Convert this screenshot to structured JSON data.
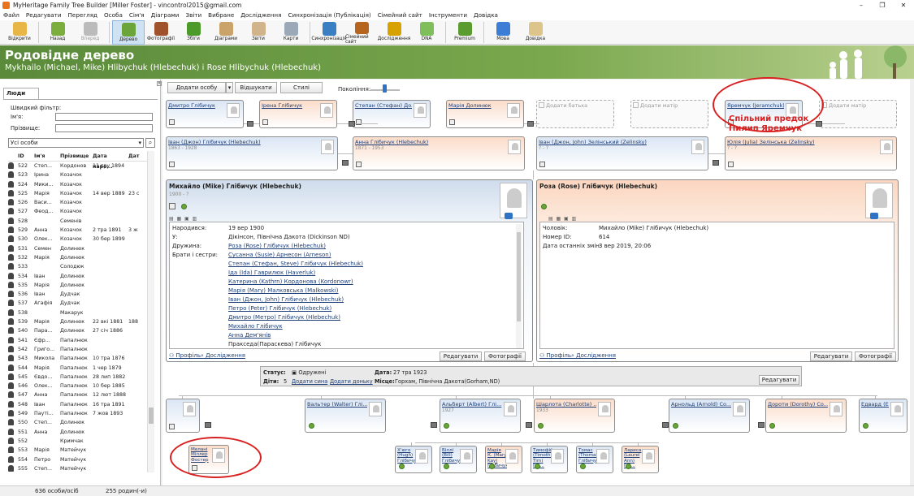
{
  "window": {
    "title": "MyHeritage Family Tree Builder [Miller Foster] - vincontrol2015@gmail.com",
    "min": "–",
    "max": "❐",
    "close": "✕"
  },
  "menu": [
    "Файл",
    "Редагувати",
    "Перегляд",
    "Особа",
    "Сім'я",
    "Діаграми",
    "Звіти",
    "Вибране",
    "Дослідження",
    "Синхронізація (Публікація)",
    "Сімейний сайт",
    "Інструменти",
    "Довідка"
  ],
  "toolbar": [
    {
      "label": "Відкрити",
      "icon": "folder-icon",
      "color": "#e8b646"
    },
    {
      "label": "Назад",
      "icon": "back-arrow-icon",
      "color": "#7cae3e"
    },
    {
      "label": "Вперед",
      "icon": "forward-arrow-icon",
      "color": "#bbbbbb"
    },
    {
      "label": "Дерево",
      "icon": "tree-icon",
      "color": "#6ba539"
    },
    {
      "label": "Фотографії",
      "icon": "photos-icon",
      "color": "#a0522d"
    },
    {
      "label": "Збіги",
      "icon": "matches-icon",
      "color": "#4c9a2a"
    },
    {
      "label": "Діаграми",
      "icon": "charts-icon",
      "color": "#c9a36a"
    },
    {
      "label": "Звіти",
      "icon": "reports-icon",
      "color": "#d2b48c"
    },
    {
      "label": "Карти",
      "icon": "map-icon",
      "color": "#9aa8b8"
    },
    {
      "label": "Синхронізація",
      "icon": "sync-icon",
      "color": "#3a7fc1"
    },
    {
      "label": "Сімейний сайт",
      "icon": "family-site-icon",
      "color": "#b5651d"
    },
    {
      "label": "Дослідження",
      "icon": "research-icon",
      "color": "#d7a100"
    },
    {
      "label": "DNA",
      "icon": "dna-icon",
      "color": "#7fbf5b"
    },
    {
      "label": "Premium",
      "icon": "premium-icon",
      "color": "#5a9c2f"
    },
    {
      "label": "Мова",
      "icon": "language-icon",
      "color": "#3c7dd6"
    },
    {
      "label": "Довідка",
      "icon": "help-icon",
      "color": "#dcc48a"
    }
  ],
  "banner": {
    "title": "Родовідне дерево",
    "subtitle": "Mykhailo (Michael, Mike) Hlibychuk (Hlebechuk) і Rose Hlibychuk (Hlebechuk)"
  },
  "left": {
    "tab": "Люди",
    "filter_title": "Швидкий фільтр:",
    "name_label": "Ім'я:",
    "surname_label": "Прізвище:",
    "filter_select": "Усі особи",
    "columns": [
      "",
      "ID",
      "Ім'я",
      "Прізвище",
      "Дата наро...",
      "Дат"
    ],
    "rows": [
      [
        "522",
        "Степ...",
        "Кордонов",
        "11 гру 1894",
        ""
      ],
      [
        "523",
        "Ірина",
        "Козачок",
        "",
        ""
      ],
      [
        "524",
        "Мики...",
        "Козачок",
        "",
        ""
      ],
      [
        "525",
        "Марія",
        "Козачок",
        "14 вер 1889",
        "23 с"
      ],
      [
        "526",
        "Васи...",
        "Козачок",
        "",
        ""
      ],
      [
        "527",
        "Феод...",
        "Козачок",
        "",
        ""
      ],
      [
        "528",
        "",
        "Семенів",
        "",
        ""
      ],
      [
        "529",
        "Анна",
        "Козачок",
        "2 тра 1891",
        "3 ж"
      ],
      [
        "530",
        "Олек...",
        "Козачок",
        "30 бер 1899",
        ""
      ],
      [
        "531",
        "Семен",
        "Долинюк",
        "",
        ""
      ],
      [
        "532",
        "Марія",
        "Долинюк",
        "",
        ""
      ],
      [
        "533",
        "",
        "Солодюк",
        "",
        ""
      ],
      [
        "534",
        "Іван",
        "Долинюк",
        "",
        ""
      ],
      [
        "535",
        "Марія",
        "Долинюк",
        "",
        ""
      ],
      [
        "536",
        "Іван",
        "Дудчак",
        "",
        ""
      ],
      [
        "537",
        "Агафія",
        "Дудчак",
        "",
        ""
      ],
      [
        "538",
        "",
        "Макарук",
        "",
        ""
      ],
      [
        "539",
        "Марія",
        "Долинюк",
        "22 вкі 1881",
        "188"
      ],
      [
        "540",
        "Пара...",
        "Долинюк",
        "27 січ 1886",
        ""
      ],
      [
        "541",
        "Єфр...",
        "Папалнюк",
        "",
        ""
      ],
      [
        "542",
        "Григо...",
        "Папалнюк",
        "",
        ""
      ],
      [
        "543",
        "Миколa",
        "Папалнюк",
        "10 тра 1876",
        ""
      ],
      [
        "544",
        "Марія",
        "Папалнюк",
        "1 чер 1879",
        ""
      ],
      [
        "545",
        "Євдо...",
        "Папалнюк",
        "28 лип 1882",
        ""
      ],
      [
        "546",
        "Олек...",
        "Папалнюк",
        "10 бер 1885",
        ""
      ],
      [
        "547",
        "Анна",
        "Папалнюк",
        "12 лют 1888",
        ""
      ],
      [
        "548",
        "Іван",
        "Папалнюк",
        "16 тра 1891",
        ""
      ],
      [
        "549",
        "Пауті...",
        "Папалнюк",
        "7 жов 1893",
        ""
      ],
      [
        "550",
        "Степ...",
        "Долинюк",
        "",
        ""
      ],
      [
        "551",
        "Анна",
        "Долинюк",
        "",
        ""
      ],
      [
        "552",
        "",
        "Кримчак",
        "",
        ""
      ],
      [
        "553",
        "Марія",
        "Матейчук",
        "",
        ""
      ],
      [
        "554",
        "Петро",
        "Матейчук",
        "",
        ""
      ],
      [
        "555",
        "Степ...",
        "Матейчук",
        "",
        ""
      ]
    ]
  },
  "status": {
    "persons": "636 особи/осіб",
    "families": "255 родин(-и)"
  },
  "tree": {
    "add_person": "Додати особу",
    "find": "Відшукати",
    "styles": "Стилі",
    "generations": "Покоління:",
    "ggp": [
      {
        "name": "Дмитро Глібичук",
        "sex": "m"
      },
      {
        "name": "Ірена Глібичук",
        "sex": "f"
      },
      {
        "name": "Степан (Стефан) Долинюк",
        "sex": "m"
      },
      {
        "name": "Марія Долинюк",
        "sex": "f"
      },
      {
        "name": "Додати батька",
        "sex": "add"
      },
      {
        "name": "Додати матір",
        "sex": "add"
      },
      {
        "name": "Яремчук (Jeramchuk)",
        "sex": "m"
      },
      {
        "name": "Додати матір",
        "sex": "add"
      }
    ],
    "gp": [
      {
        "name": "Іван (Джон) Глібичук (Hlebechuk)",
        "dates": "1863 - 1928",
        "sex": "m"
      },
      {
        "name": "Анна Глібичук (Hlebechuk)",
        "dates": "1871 - 1953",
        "sex": "f"
      },
      {
        "name": "Іван (Джон, John) Зелінський (Zelinsky)",
        "dates": "? - ?",
        "sex": "m"
      },
      {
        "name": "Юлія (Julia) Зелінська (Zelinsky)",
        "dates": "? - ?",
        "sex": "f"
      }
    ],
    "husband": {
      "name": "Михайло (Mike) Глібичук (Hlebechuk)",
      "dates": "1900 - ?",
      "fields": [
        [
          "Народився:",
          "19 вер 1900"
        ],
        [
          "У:",
          "Дікінсон, Північна Дакота (Dickinson ND)"
        ],
        [
          "Дружина:",
          "Роза (Rose) Глібичук (Hlebechuk)"
        ],
        [
          "Брати і сестри:",
          "Сусанна (Susie) Арнесон (Arneson)"
        ]
      ],
      "siblings": [
        "Степан (Стефан, Steve) Глібичук (Hlebechuk)",
        "Іда (Ida) Гаврилюк (Haverluk)",
        "Катерина (Kathrn) Кордонова (Kordonowr)",
        "Марія (Mary) Малковська (Malkowski)",
        "Іван (Джон, John) Глібичук (Hlebechuk)",
        "Петро (Peter) Глібичук (Hlebechuk)",
        "Дмитро (Метро) Глібичук (Hlebechuk)",
        "Михайло Глібичук",
        "Анна Дем'янів",
        "Прaксeдa(Параскева) Глібичук"
      ],
      "profile": "Профіль",
      "research": "Дослідження",
      "edit": "Редагувати",
      "photos": "Фотографії"
    },
    "wife": {
      "name": "Роза (Rose) Глібичук (Hlebechuk)",
      "fields": [
        [
          "Чоловік:",
          "Михайло (Mike) Глібичук (Hlebechuk)"
        ],
        [
          "Номер ID:",
          "614"
        ],
        [
          "Дата останніх змін:",
          "3 вер 2019, 20:06"
        ]
      ],
      "profile": "Профіль",
      "research": "Дослідження",
      "edit": "Редагувати",
      "photos": "Фотографії"
    },
    "family": {
      "status_label": "Статус:",
      "status": "Одружені",
      "date_label": "Дата:",
      "date": "27 тра 1923",
      "children_label": "Діти:",
      "children": "5",
      "add_son": "Додати сина",
      "add_daughter": "Додати доньку",
      "place_label": "Місце:",
      "place": "Горхам, Північна Дакота(Gorham,ND)",
      "edit": "Редагувати"
    },
    "children": [
      {
        "name": "Вальтер (Walter) Глі...",
        "dates": "",
        "sex": "m"
      },
      {
        "name": "Альберт (Albert) Глі...",
        "dates": "1927",
        "sex": "m"
      },
      {
        "name": "Шарлота (Charlotte) ...",
        "dates": "1933",
        "sex": "f"
      },
      {
        "name": "Арнольд (Arnold) Co...",
        "dates": "",
        "sex": "m"
      },
      {
        "name": "Дороти (Dorothy) Co...",
        "dates": "",
        "sex": "f"
      },
      {
        "name": "Едвард (Edward) Гл...",
        "dates": "",
        "sex": "m"
      }
    ],
    "grandchildren": [
      {
        "name": "Х'юго (Hugh) Глібичук",
        "sex": "m"
      },
      {
        "name": "Біллі (Bill) Глібичук",
        "sex": "m"
      },
      {
        "name": "Марія К. (Mary Kay) Глібичук",
        "sex": "f"
      },
      {
        "name": "Тимофій (Timothy, Tim) Глі...",
        "sex": "m"
      },
      {
        "name": "Томас (Thomas) Глібичук",
        "sex": "m"
      },
      {
        "name": "Лариса (Laurel Ann) Глі...",
        "sex": "f"
      }
    ],
    "melani": "Мелані Міллер Фостер",
    "annotation": [
      "Спільний предок",
      "Пилип Яремчук"
    ]
  },
  "colors": {
    "accent_red": "#d92020",
    "banner_green": "#6b9b44",
    "male": "#dbe6f4",
    "female": "#fbdcc9"
  }
}
